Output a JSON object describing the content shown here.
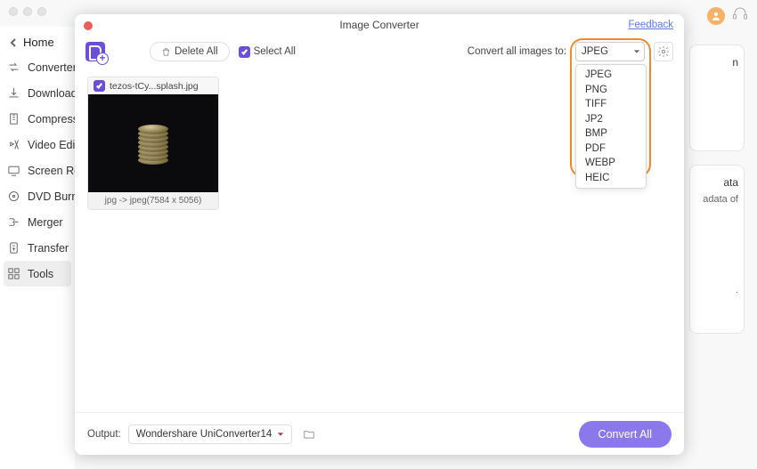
{
  "sidebar": {
    "home_label": "Home",
    "items": [
      {
        "label": "Converter"
      },
      {
        "label": "Downloader"
      },
      {
        "label": "Compressor"
      },
      {
        "label": "Video Editor"
      },
      {
        "label": "Screen Recorder"
      },
      {
        "label": "DVD Burner"
      },
      {
        "label": "Merger"
      },
      {
        "label": "Transfer"
      },
      {
        "label": "Tools"
      }
    ]
  },
  "right_peek": {
    "heading": "ata",
    "sub": "adata of",
    "foot": "."
  },
  "modal": {
    "title": "Image Converter",
    "feedback_label": "Feedback",
    "delete_all_label": "Delete All",
    "select_all_label": "Select All",
    "convert_to_label": "Convert all images to:",
    "format_selected": "JPEG",
    "format_options": [
      "JPEG",
      "PNG",
      "TIFF",
      "JP2",
      "BMP",
      "PDF",
      "WEBP",
      "HEIC"
    ],
    "thumb": {
      "filename": "tezos-tCy...splash.jpg",
      "footer": "jpg -> jpeg(7584 x 5056)"
    },
    "output_label": "Output:",
    "output_path": "Wondershare UniConverter14",
    "convert_button": "Convert All"
  }
}
